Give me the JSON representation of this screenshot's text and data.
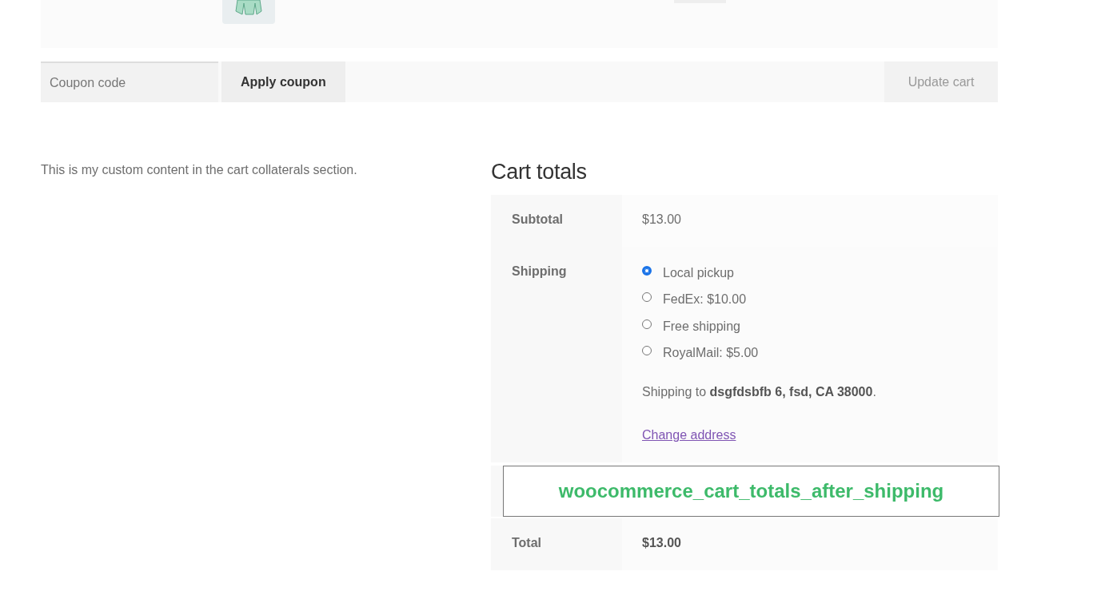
{
  "coupon": {
    "placeholder": "Coupon code",
    "apply_button": "Apply coupon"
  },
  "update_button": {
    "label": "Update cart",
    "disabled": true
  },
  "collaterals_text": "This is my custom content in the cart collaterals section.",
  "cart_totals": {
    "title": "Cart totals",
    "subtotal": {
      "label": "Subtotal",
      "value": "$13.00"
    },
    "shipping": {
      "label": "Shipping",
      "options": [
        {
          "label": "Local pickup",
          "selected": true
        },
        {
          "label": "FedEx: $10.00",
          "selected": false
        },
        {
          "label": "Free shipping",
          "selected": false
        },
        {
          "label": "RoyalMail: $5.00",
          "selected": false
        }
      ],
      "destination": "Shipping to **dsgfdsbfb 6, fsd, CA 38000**.",
      "change_link": "Change address"
    },
    "hook_label": "woocommerce_cart_totals_after_shipping",
    "total": {
      "label": "Total",
      "value": "$13.00"
    }
  }
}
